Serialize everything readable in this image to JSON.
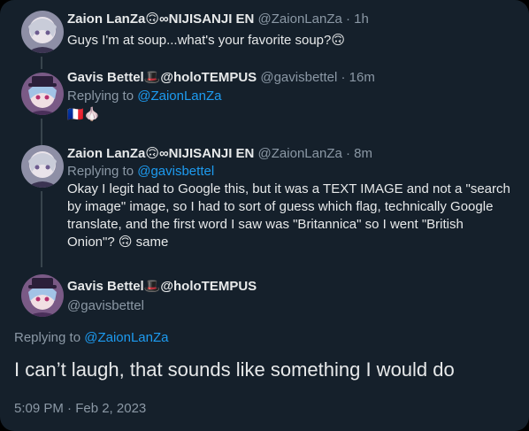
{
  "colors": {
    "background": "#15202b",
    "text": "#e7e9ea",
    "muted": "#8b98a5",
    "link": "#1d9bf0",
    "thread_line": "#38444d"
  },
  "tweets": [
    {
      "name": "Zaion LanZa",
      "badges": "🙃∞NIJISANJI EN",
      "handle": "@ZaionLanZa",
      "separator": "·",
      "time": "1h",
      "text": "Guys I'm at soup...what's your favorite soup?",
      "trailing_emoji": "🙃"
    },
    {
      "name": "Gavis Bettel",
      "badges": "🎩@holoTEMPUS",
      "handle": "@gavisbettel",
      "separator": "·",
      "time": "16m",
      "replying_label": "Replying to",
      "replying_handle": "@ZaionLanZa",
      "text": "🇫🇷🧄"
    },
    {
      "name": "Zaion LanZa",
      "badges": "🙃∞NIJISANJI EN",
      "handle": "@ZaionLanZa",
      "separator": "·",
      "time": "8m",
      "replying_label": "Replying to",
      "replying_handle": "@gavisbettel",
      "text_lines": [
        "Okay I legit had to Google this, but it was a TEXT IMAGE and not a \"search",
        "by image\" image, so I had to sort of guess which flag, technically Google",
        "translate, and the first word I saw was \"Britannica\" so I went \"British",
        "Onion\"? 🙃 same"
      ]
    }
  ],
  "main_tweet": {
    "name": "Gavis Bettel",
    "badges": "🎩@holoTEMPUS",
    "handle": "@gavisbettel",
    "replying_label": "Replying to",
    "replying_handle": "@ZaionLanZa",
    "text": "I can’t laugh, that sounds like something I would do",
    "timestamp": "5:09 PM · Feb 2, 2023"
  }
}
